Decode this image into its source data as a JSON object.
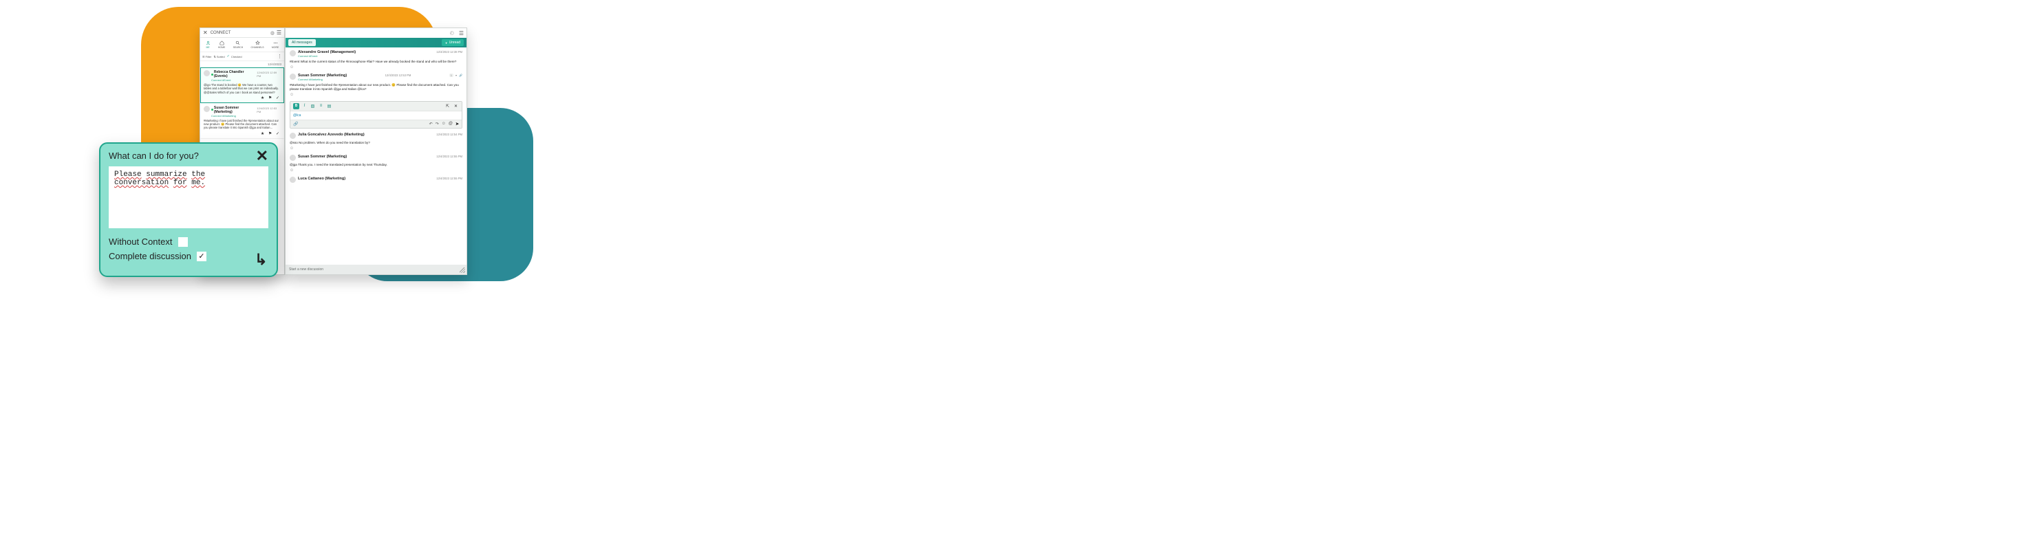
{
  "app": {
    "title": "CONNECT"
  },
  "nav": {
    "items": [
      {
        "label": "ME"
      },
      {
        "label": "HOME"
      },
      {
        "label": "SEARCH"
      },
      {
        "label": "CHANNELS"
      },
      {
        "label": "MORE"
      }
    ]
  },
  "filters": {
    "filter_label": "Filter",
    "sorted_label": "Sorted",
    "checked_label": "Checked"
  },
  "left_date": "12/4/2023",
  "threads": [
    {
      "name": "Rebecca Chandler (Events)",
      "sub": "Connect #Event",
      "time": "12/4/2023 12:59 PM",
      "body": "@igo The stand is booked 😊 We have a counter, two tables and a table/bar wall that we can print on individually. @@Sales Which of you can I book as stand personnel?",
      "selected": true
    },
    {
      "name": "Susan Sommer (Marketing)",
      "sub": "Connect #Marketing",
      "time": "12/4/2023 12:53 PM",
      "body": "#Marketing I have just finished the #presentation about our new product. 😊 Please find the document attached. Can you please translate it into Spanish @jga and Italian…",
      "selected": false
    }
  ],
  "messages": {
    "tab_all": "All messages",
    "unread_label": "Unread",
    "items": [
      {
        "name": "Alexandre Gravel (Management)",
        "sub": "Connect #Event",
        "time": "12/4/2023 12:38 PM",
        "body": "#Event What is the current status of the #innovaphone #fair? Have we already booked the stand and who will be there?"
      },
      {
        "name": "Susan Sommer (Marketing)",
        "sub": "Connect #Marketing",
        "time": "12/4/2023 12:53 PM",
        "body": "#Marketing I have just finished the #presentation about our new product. 😊 Please find the document attached. Can you please translate it into Spanish @jga and Italian @lca?",
        "meta_count": "1",
        "meta_attach": true,
        "has_reply_box": true,
        "reply_mention": "@lca"
      },
      {
        "name": "Julia Goncalvez Azevedo (Marketing)",
        "sub": "",
        "time": "12/4/2023 12:54 PM",
        "body": "@sso No problem. When do you need the translation by?"
      },
      {
        "name": "Susan Sommer (Marketing)",
        "sub": "",
        "time": "12/4/2023 12:55 PM",
        "body": "@jga Thank you. I need the translated presentation by next Thursday."
      },
      {
        "name": "Luca Cattaneo (Marketing)",
        "sub": "",
        "time": "12/4/2023 12:55 PM",
        "body": ""
      }
    ],
    "new_discussion": "Start a new discussion"
  },
  "ai": {
    "title": "What can I do for you?",
    "input_words": [
      "Please",
      "summarize",
      "the",
      "conversation",
      "for",
      "me."
    ],
    "without_context": "Without Context",
    "complete_discussion": "Complete discussion",
    "without_checked": false,
    "complete_checked": true
  }
}
